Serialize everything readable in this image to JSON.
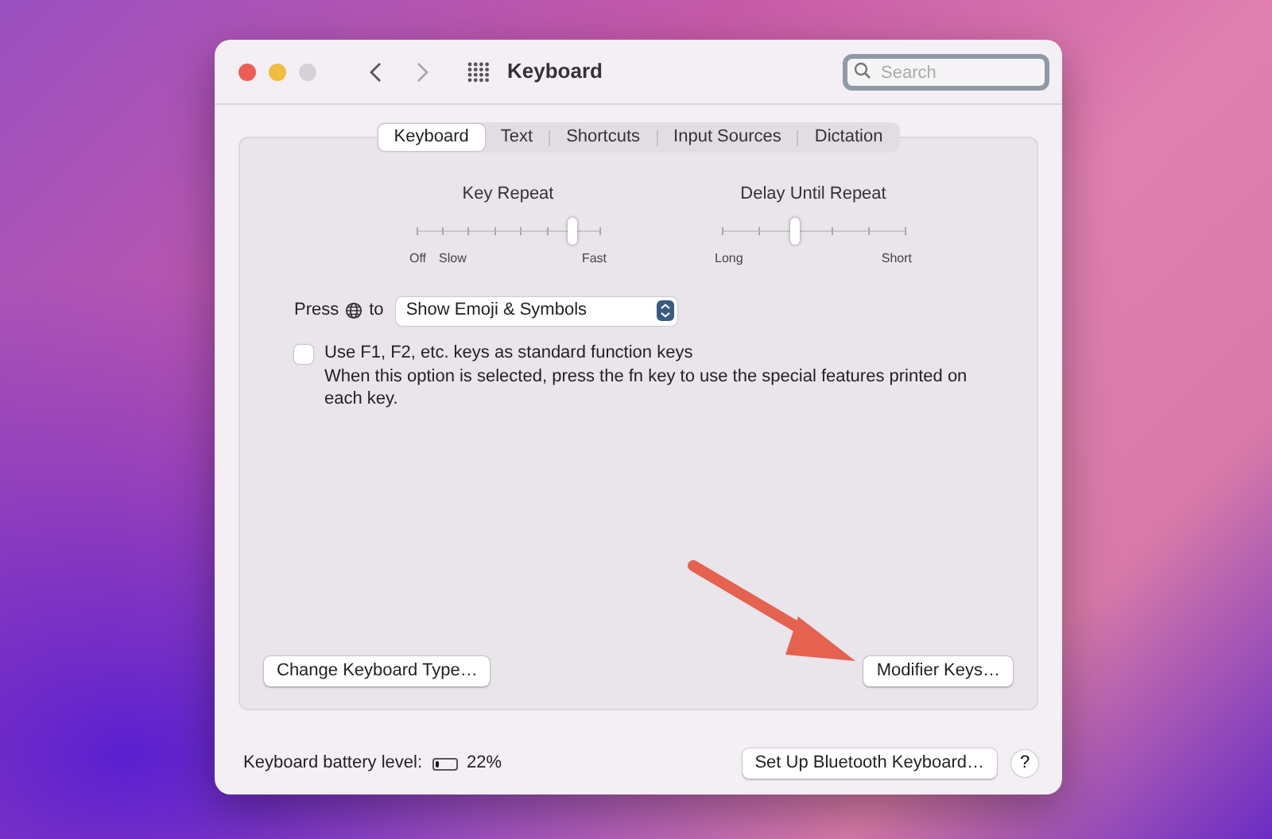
{
  "window": {
    "title": "Keyboard"
  },
  "search": {
    "placeholder": "Search"
  },
  "tabs": [
    {
      "label": "Keyboard",
      "selected": true
    },
    {
      "label": "Text",
      "selected": false
    },
    {
      "label": "Shortcuts",
      "selected": false
    },
    {
      "label": "Input Sources",
      "selected": false
    },
    {
      "label": "Dictation",
      "selected": false
    }
  ],
  "sliders": [
    {
      "title": "Key Repeat",
      "kind": "fine",
      "level": 0.857,
      "labels": [
        "Off",
        "Slow",
        "Fast"
      ]
    },
    {
      "title": "Delay Until Repeat",
      "kind": "coarse",
      "level": 0.4,
      "labels": [
        "Long",
        "Short"
      ]
    }
  ],
  "press_row": {
    "label_before": "Press",
    "label_after": "to",
    "value": "Show Emoji & Symbols"
  },
  "function_keys": {
    "label": "Use F1, F2, etc. keys as standard function keys",
    "checked": false,
    "description": "When this option is selected, press the fn key to use the special features printed on each key."
  },
  "panel_buttons": [
    "Change Keyboard Type…",
    "Modifier Keys…"
  ],
  "battery": {
    "label": "Keyboard battery level:",
    "level": 0.22,
    "reading": "22%"
  },
  "footer_button": "Set Up Bluetooth Keyboard…",
  "help_button": "?"
}
